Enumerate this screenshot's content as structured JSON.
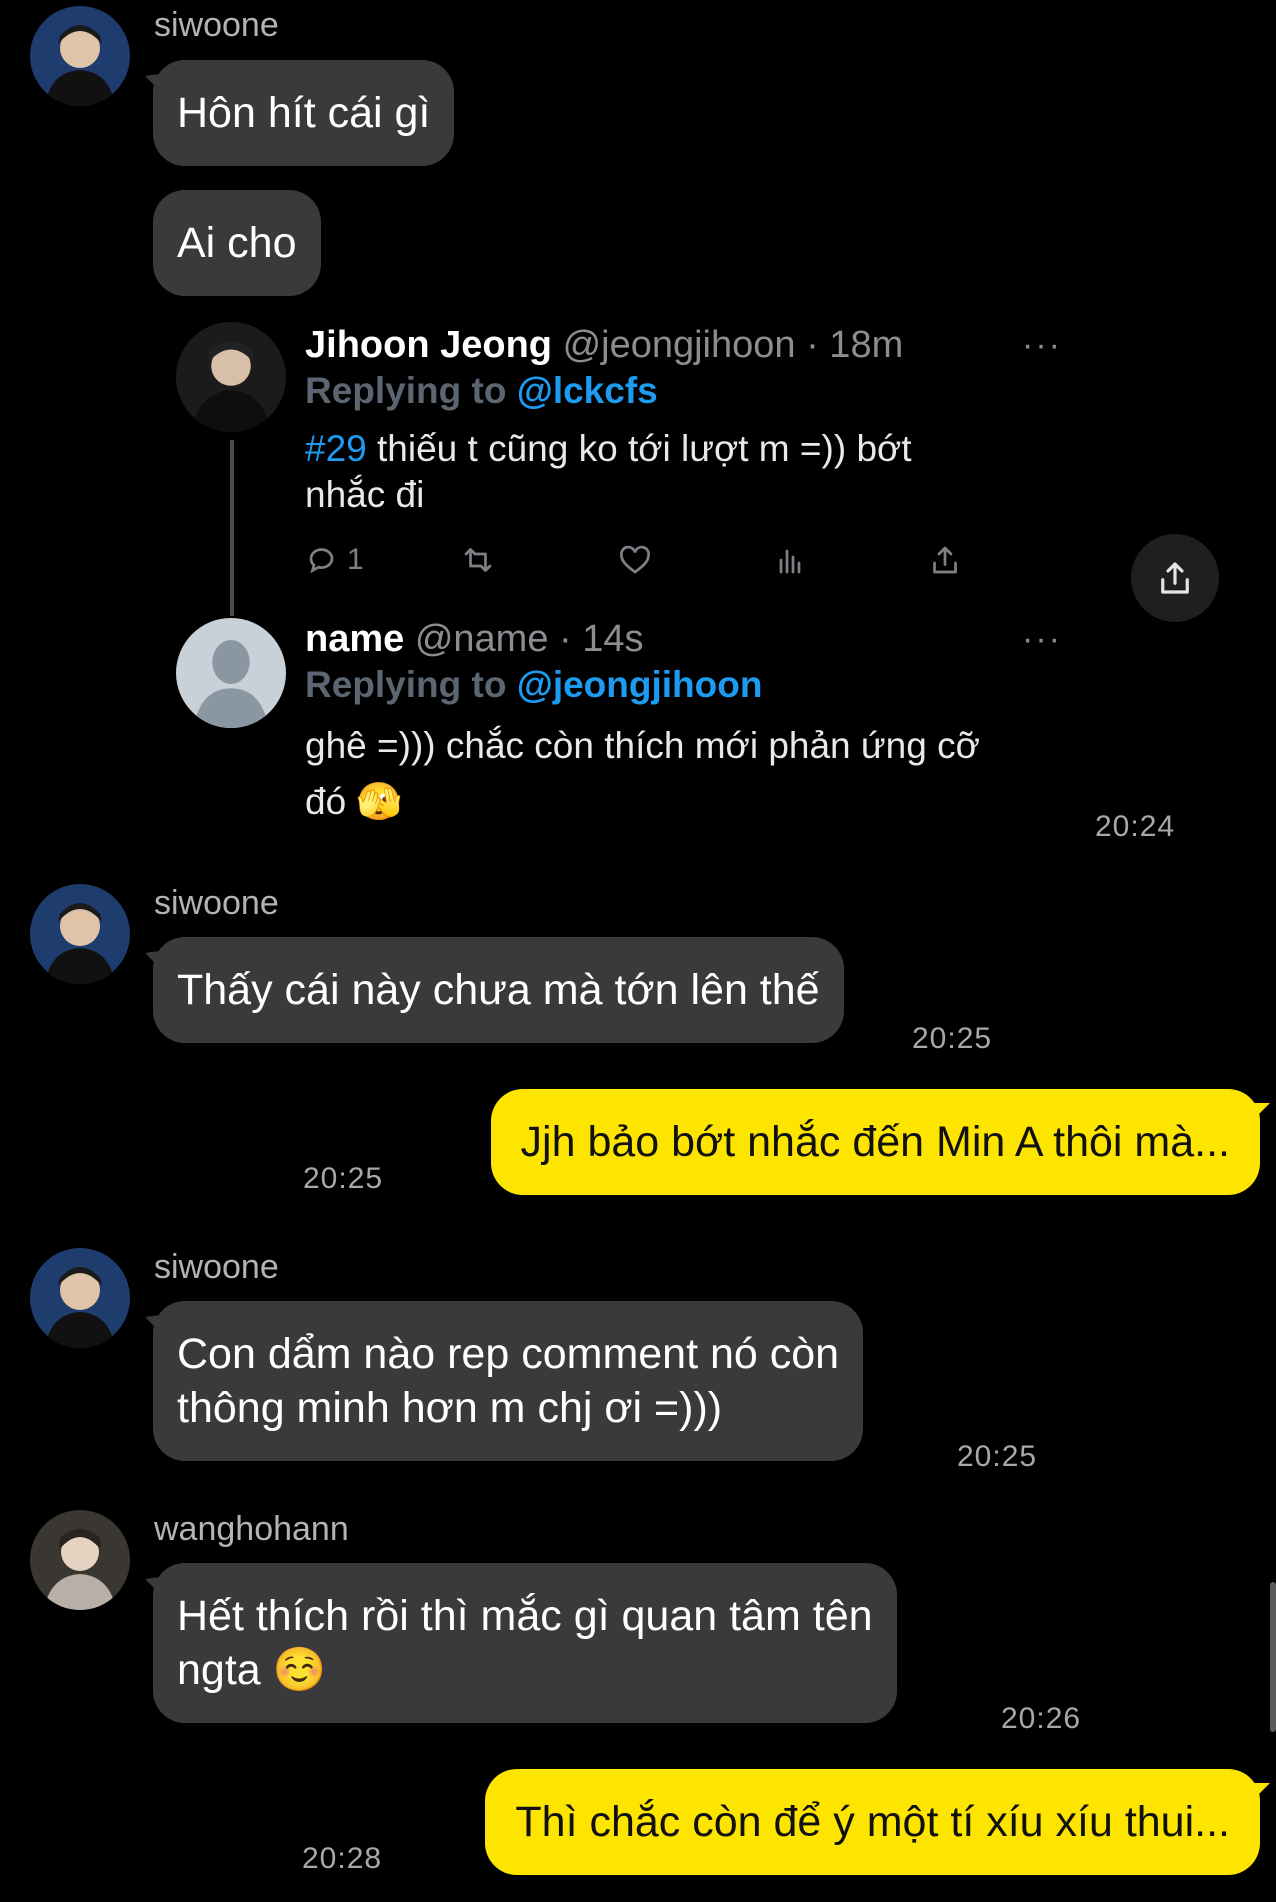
{
  "colors": {
    "background": "#000000",
    "incoming_bubble": "#3a3a3c",
    "outgoing_bubble": "#fee500",
    "mention": "#1d9bf0"
  },
  "messages": {
    "m1": {
      "sender": "siwoone",
      "text": "Hôn hít cái gì"
    },
    "m2": {
      "text": "Ai cho"
    },
    "m3": {
      "time": "20:24"
    },
    "m4": {
      "sender": "siwoone",
      "text": "Thấy cái này chưa mà tớn lên thế",
      "time": "20:25"
    },
    "m5": {
      "text": "Jjh bảo bớt nhắc đến Min A thôi mà...",
      "time": "20:25"
    },
    "m6": {
      "sender": "siwoone",
      "line1": "Con dẩm nào rep comment nó còn",
      "line2": "thông minh hơn m chj ơi =)))",
      "time": "20:25"
    },
    "m7": {
      "sender": "wanghohann",
      "line1": "Hết thích rồi thì mắc gì quan tâm tên",
      "line2": "ngta ☺️",
      "time": "20:26"
    },
    "m8": {
      "text": "Thì chắc còn để ý một tí xíu xíu thui...",
      "time": "20:28"
    }
  },
  "tweet": {
    "original": {
      "name": "Jihoon Jeong",
      "handle": "@jeongjihoon · 18m",
      "replying_prefix": "Replying to",
      "replying_to": "@lckcfs",
      "hashtag": "#29",
      "line1": " thiếu t cũng ko tới lượt m =)) bớt",
      "line2": "nhắc đi",
      "reply_count": "1",
      "more": "···"
    },
    "reply": {
      "name": "name",
      "handle": "@name · 14s",
      "replying_prefix": "Replying to",
      "replying_to": "@jeongjihoon",
      "line1": "ghê =))) chắc còn thích mới phản ứng cỡ",
      "line2": "đó 🫣",
      "more": "···"
    }
  }
}
